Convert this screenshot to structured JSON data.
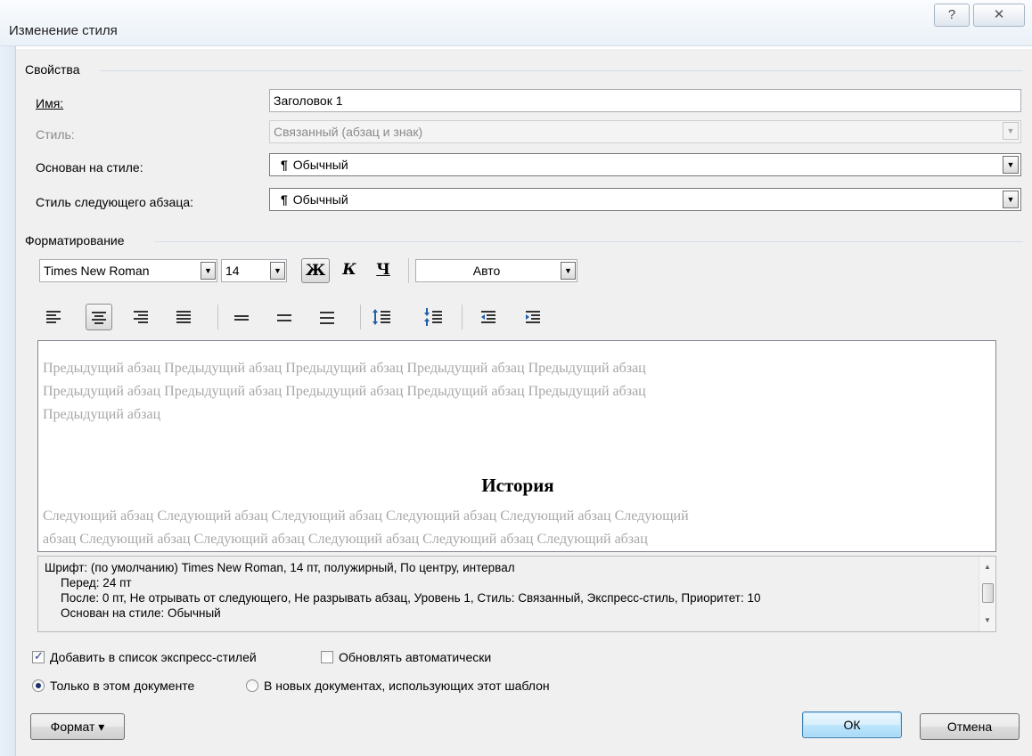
{
  "window": {
    "title": "Изменение стиля",
    "help_glyph": "?",
    "close_glyph": "✕"
  },
  "properties": {
    "section": "Свойства",
    "name_label": "Имя:",
    "name_value": "Заголовок 1",
    "style_label": "Стиль:",
    "style_value": "Связанный (абзац и знак)",
    "based_on_label": "Основан на стиле:",
    "based_on_value": "Обычный",
    "next_para_label": "Стиль следующего абзаца:",
    "next_para_value": "Обычный",
    "para_mark": "¶"
  },
  "formatting": {
    "section": "Форматирование",
    "font_name": "Times New Roman",
    "font_size": "14",
    "bold_label": "Ж",
    "italic_label": "К",
    "underline_label": "Ч",
    "color_value": "Авто",
    "alignment_selected": "center"
  },
  "preview": {
    "previous_line1": "Предыдущий абзац Предыдущий абзац Предыдущий абзац Предыдущий абзац Предыдущий абзац",
    "previous_line2": "Предыдущий абзац Предыдущий абзац Предыдущий абзац Предыдущий абзац Предыдущий абзац",
    "previous_line3": "Предыдущий абзац",
    "heading": "История",
    "next_line1": "Следующий абзац Следующий абзац Следующий абзац Следующий абзац Следующий абзац Следующий",
    "next_line2": "абзац Следующий абзац Следующий абзац Следующий абзац Следующий абзац Следующий абзац"
  },
  "description": {
    "line1": "Шрифт: (по умолчанию) Times New Roman, 14 пт, полужирный, По центру, интервал",
    "line2": "Перед:  24 пт",
    "line3": "После:  0 пт, Не отрывать от следующего, Не разрывать абзац, Уровень 1, Стиль: Связанный, Экспресс-стиль, Приоритет: 10",
    "line4": "Основан на стиле: Обычный"
  },
  "options": {
    "add_quick_styles": "Добавить в список экспресс-стилей",
    "add_quick_styles_checked": true,
    "auto_update": "Обновлять автоматически",
    "auto_update_checked": false,
    "only_this_doc": "Только в этом документе",
    "new_docs": "В новых документах, использующих этот шаблон",
    "selected_scope": "only_this_doc"
  },
  "buttons": {
    "format": "Формат",
    "format_arrow": "▾",
    "ok": "ОК",
    "cancel": "Отмена"
  },
  "colors": {
    "accent": "#3c7fb1",
    "window_bg": "#f0f0f0",
    "preview_gray": "#a7a7a7"
  }
}
